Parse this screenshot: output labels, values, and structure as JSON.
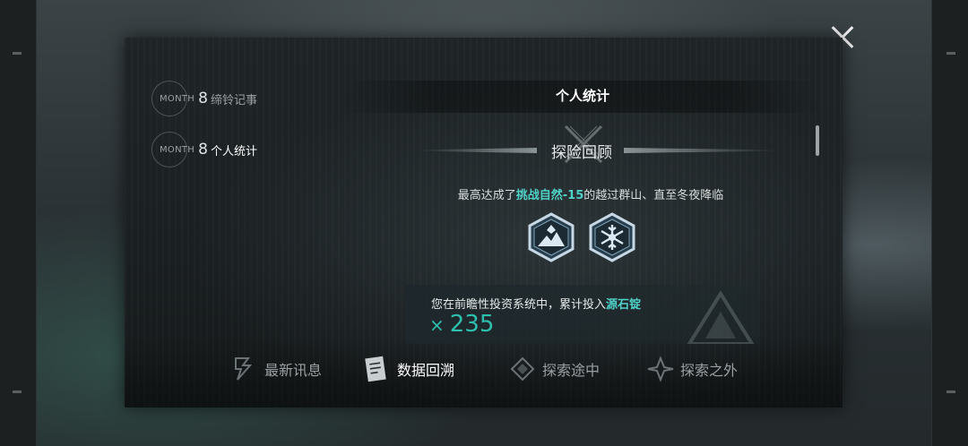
{
  "nav": {
    "items": [
      {
        "badge_text": "MONTH",
        "badge_num": "8",
        "label": "缔铃记事"
      },
      {
        "badge_text": "MONTH",
        "badge_num": "8",
        "label": "个人统计"
      }
    ]
  },
  "content": {
    "title": "个人统计",
    "section_title": "探险回顾",
    "summary_prefix": "最高达成了",
    "summary_highlight": "挑战自然-15",
    "summary_suffix": "的越过群山、直至冬夜降临",
    "invest_prefix": "您在前瞻性投资系统中，累计投入",
    "invest_highlight": "源石锭",
    "invest_symbol": "×",
    "invest_amount": "235"
  },
  "tabs": [
    {
      "label": "最新讯息",
      "icon": "news-icon",
      "active": false
    },
    {
      "label": "数据回溯",
      "icon": "data-review-icon",
      "active": true
    },
    {
      "label": "探索途中",
      "icon": "explore-icon",
      "active": false
    },
    {
      "label": "探索之外",
      "icon": "beyond-icon",
      "active": false
    }
  ],
  "colors": {
    "accent": "#4fd1c8",
    "amount": "#2fbfae",
    "panel": "#1b2022"
  }
}
